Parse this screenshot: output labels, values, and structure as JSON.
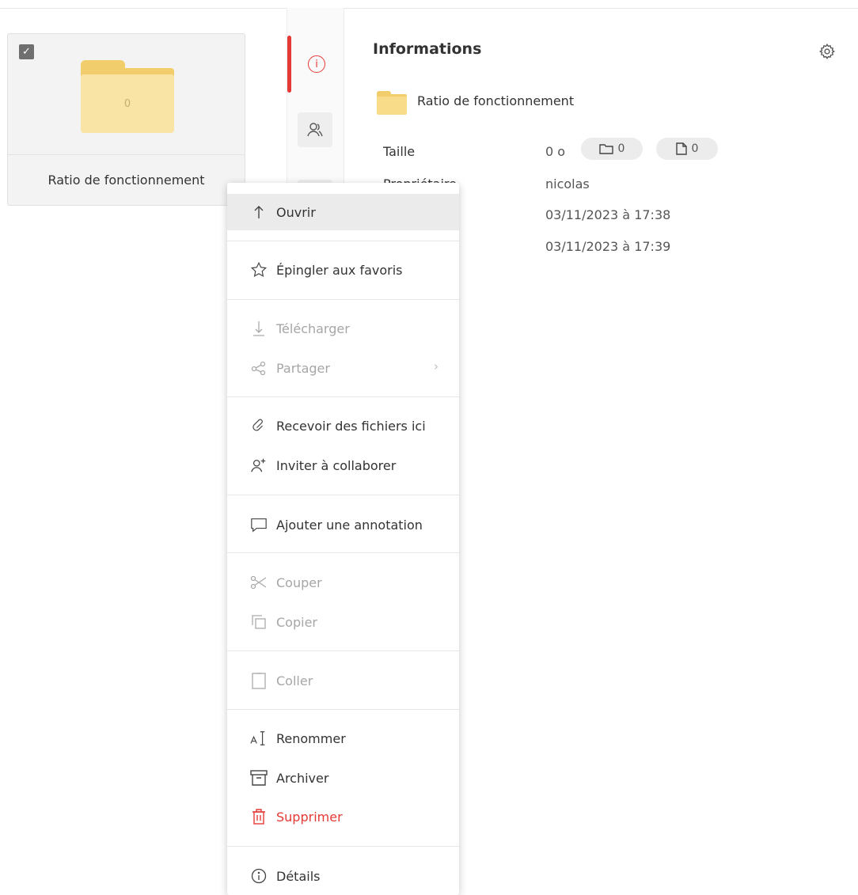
{
  "file_card": {
    "name": "Ratio de fonctionnement",
    "item_count": "0",
    "checkbox_mark": "✓",
    "selected": true
  },
  "side_tabs": {
    "active": "info",
    "info_glyph": "i"
  },
  "info_panel": {
    "title": "Informations",
    "folder_name": "Ratio de fonctionnement",
    "size_label": "Taille",
    "size_value": "0 o",
    "folders_count": "0",
    "files_count": "0",
    "owner_label": "Propriétaire",
    "owner_value": "nicolas",
    "created_value": "03/11/2023 à 17:38",
    "modified_value": "03/11/2023 à 17:39"
  },
  "context_menu": {
    "open": "Ouvrir",
    "pin": "Épingler aux favoris",
    "download": "Télécharger",
    "share": "Partager",
    "receive": "Recevoir des fichiers ici",
    "invite": "Inviter à collaborer",
    "annotate": "Ajouter une annotation",
    "cut": "Couper",
    "copy": "Copier",
    "paste": "Coller",
    "rename": "Renommer",
    "archive": "Archiver",
    "delete": "Supprimer",
    "details": "Détails",
    "chevron": "›"
  },
  "colors": {
    "accent_red": "#e53935",
    "folder_yellow": "#f9e3a5",
    "disabled_text": "#a6a6a6"
  },
  "icons": [
    "check-icon",
    "folder-icon",
    "info-icon",
    "share-people-icon",
    "gear-icon",
    "folder-pill-icon",
    "file-pill-icon",
    "arrow-up-icon",
    "star-icon",
    "download-icon",
    "share-icon",
    "link-icon",
    "add-user-icon",
    "comment-icon",
    "scissors-icon",
    "copy-icon",
    "clipboard-icon",
    "rename-icon",
    "archive-icon",
    "trash-icon",
    "info-circle-icon",
    "chevron-right-icon"
  ]
}
